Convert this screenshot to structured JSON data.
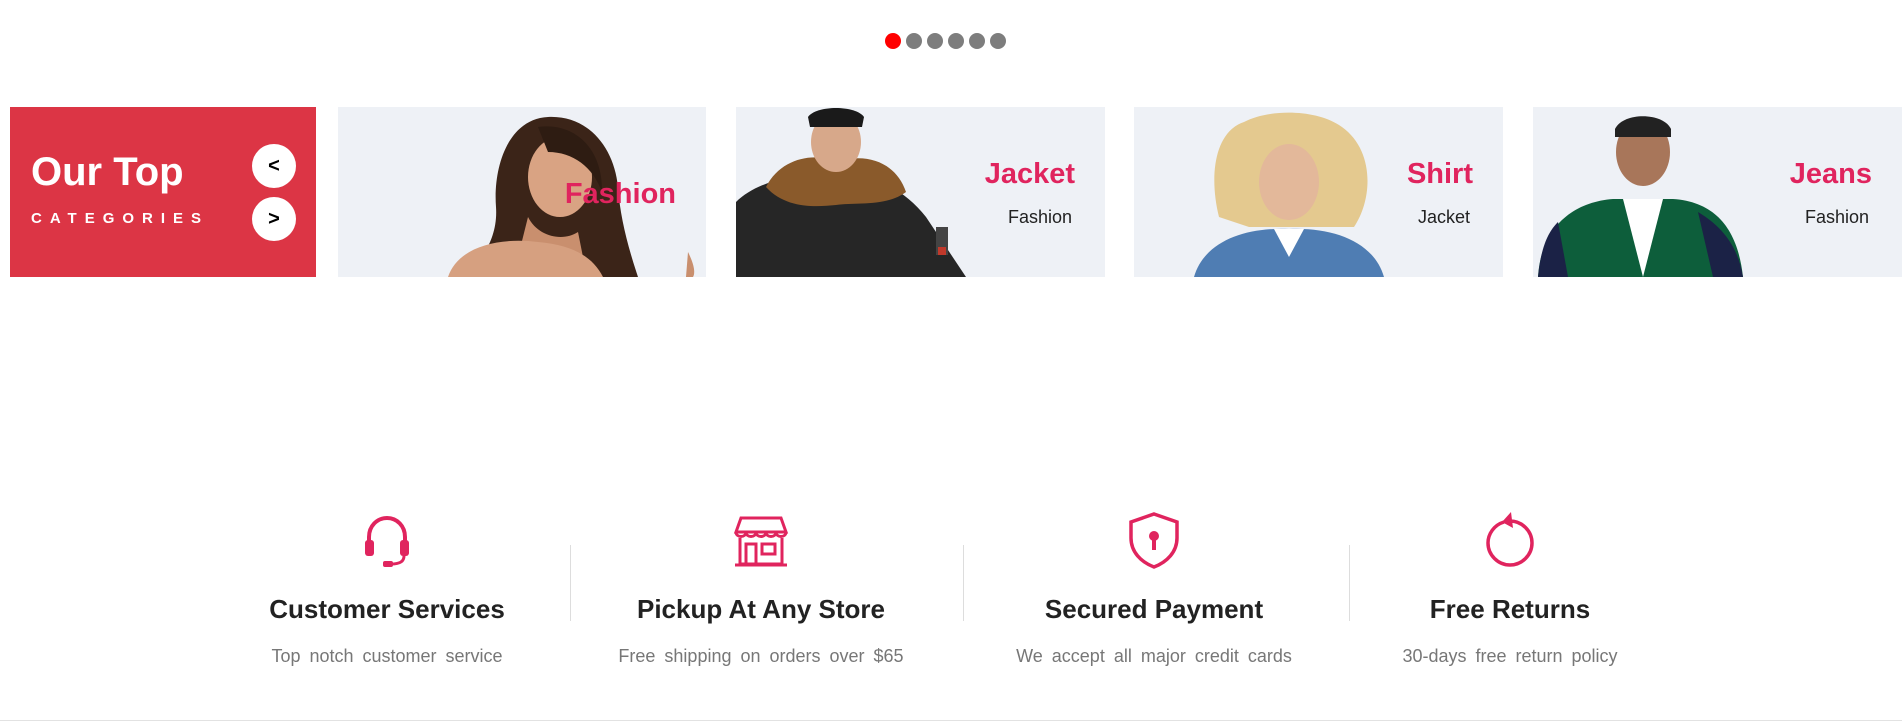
{
  "slider": {
    "dots": [
      {
        "active": true
      },
      {
        "active": false
      },
      {
        "active": false
      },
      {
        "active": false
      },
      {
        "active": false
      },
      {
        "active": false
      }
    ]
  },
  "categories": {
    "title": "Our Top",
    "subtitle": "CATEGORIES",
    "prev_label": "<",
    "next_label": ">",
    "cards": [
      {
        "title": "Fashion",
        "subtitle": ""
      },
      {
        "title": "Jacket",
        "subtitle": "Fashion"
      },
      {
        "title": "Shirt",
        "subtitle": "Jacket"
      },
      {
        "title": "Jeans",
        "subtitle": "Fashion"
      }
    ]
  },
  "services": [
    {
      "icon": "headset-icon",
      "title": "Customer Services",
      "desc": "Top notch customer service"
    },
    {
      "icon": "store-icon",
      "title": "Pickup At Any Store",
      "desc": "Free shipping on orders over $65"
    },
    {
      "icon": "shield-lock-icon",
      "title": "Secured Payment",
      "desc": "We accept all major credit cards"
    },
    {
      "icon": "rotate-icon",
      "title": "Free Returns",
      "desc": "30-days free return policy"
    }
  ],
  "colors": {
    "accent": "#dc3545",
    "title_pink": "#e0245e",
    "dot_active": "#ff0000",
    "dot_inactive": "#7d7d7d",
    "card_bg": "#eef1f6"
  }
}
